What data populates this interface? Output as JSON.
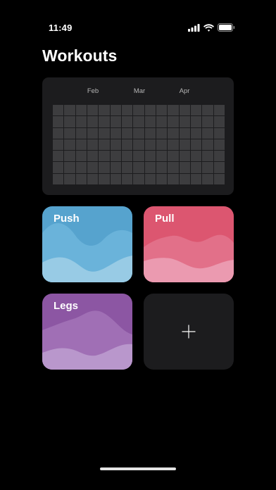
{
  "status_bar": {
    "time": "11:49",
    "icons": [
      "cellular-signal-icon",
      "wifi-icon",
      "battery-icon"
    ]
  },
  "page": {
    "title": "Workouts"
  },
  "heatmap": {
    "months": [
      "Feb",
      "Mar",
      "Apr"
    ],
    "rows": 7,
    "columns": 15,
    "cell_color": "#3d3d3f",
    "card_color": "#1c1c1e"
  },
  "workouts": [
    {
      "label": "Push",
      "colors": [
        "#56a3ce",
        "#6ab3da",
        "#98cbe5"
      ]
    },
    {
      "label": "Pull",
      "colors": [
        "#dc5670",
        "#e27089",
        "#eb9ab0"
      ]
    },
    {
      "label": "Legs",
      "colors": [
        "#8c56a3",
        "#a06fb5",
        "#b997cc"
      ]
    }
  ],
  "add_workout": {
    "icon": "plus-icon"
  },
  "colors": {
    "background": "#000000",
    "card": "#1c1c1e",
    "text": "#ffffff"
  }
}
